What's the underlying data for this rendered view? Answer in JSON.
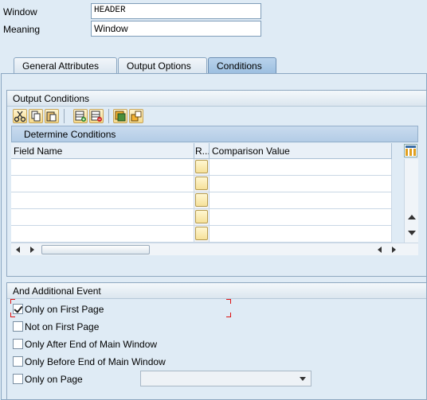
{
  "header": {
    "window_label": "Window",
    "window_value": "HEADER",
    "meaning_label": "Meaning",
    "meaning_value": "Window"
  },
  "tabs": [
    {
      "label": "General Attributes",
      "active": false
    },
    {
      "label": "Output Options",
      "active": false
    },
    {
      "label": "Conditions",
      "active": true
    }
  ],
  "output_conditions": {
    "title": "Output Conditions",
    "toolbar_icons": [
      "cut-icon",
      "copy-icon",
      "paste-icon",
      "insert-row-icon",
      "delete-row-icon",
      "select-all-icon",
      "deselect-icon"
    ],
    "table": {
      "caption": "Determine Conditions",
      "columns": [
        "Field Name",
        "R...",
        "Comparison Value"
      ],
      "rows": [
        {
          "field_name": "",
          "comparison_value": ""
        },
        {
          "field_name": "",
          "comparison_value": ""
        },
        {
          "field_name": "",
          "comparison_value": ""
        },
        {
          "field_name": "",
          "comparison_value": ""
        },
        {
          "field_name": "",
          "comparison_value": ""
        }
      ]
    }
  },
  "additional_event": {
    "title": "And Additional Event",
    "options": [
      {
        "label": "Only on First Page",
        "checked": true
      },
      {
        "label": "Not on First Page",
        "checked": false
      },
      {
        "label": "Only After End of Main Window",
        "checked": false
      },
      {
        "label": "Only Before End of Main Window",
        "checked": false
      },
      {
        "label": "Only on Page",
        "checked": false
      }
    ],
    "page_select_value": ""
  },
  "colors": {
    "background": "#dfebf5",
    "active_tab": "#9dbfe0",
    "focus_marker": "#dd1111"
  }
}
